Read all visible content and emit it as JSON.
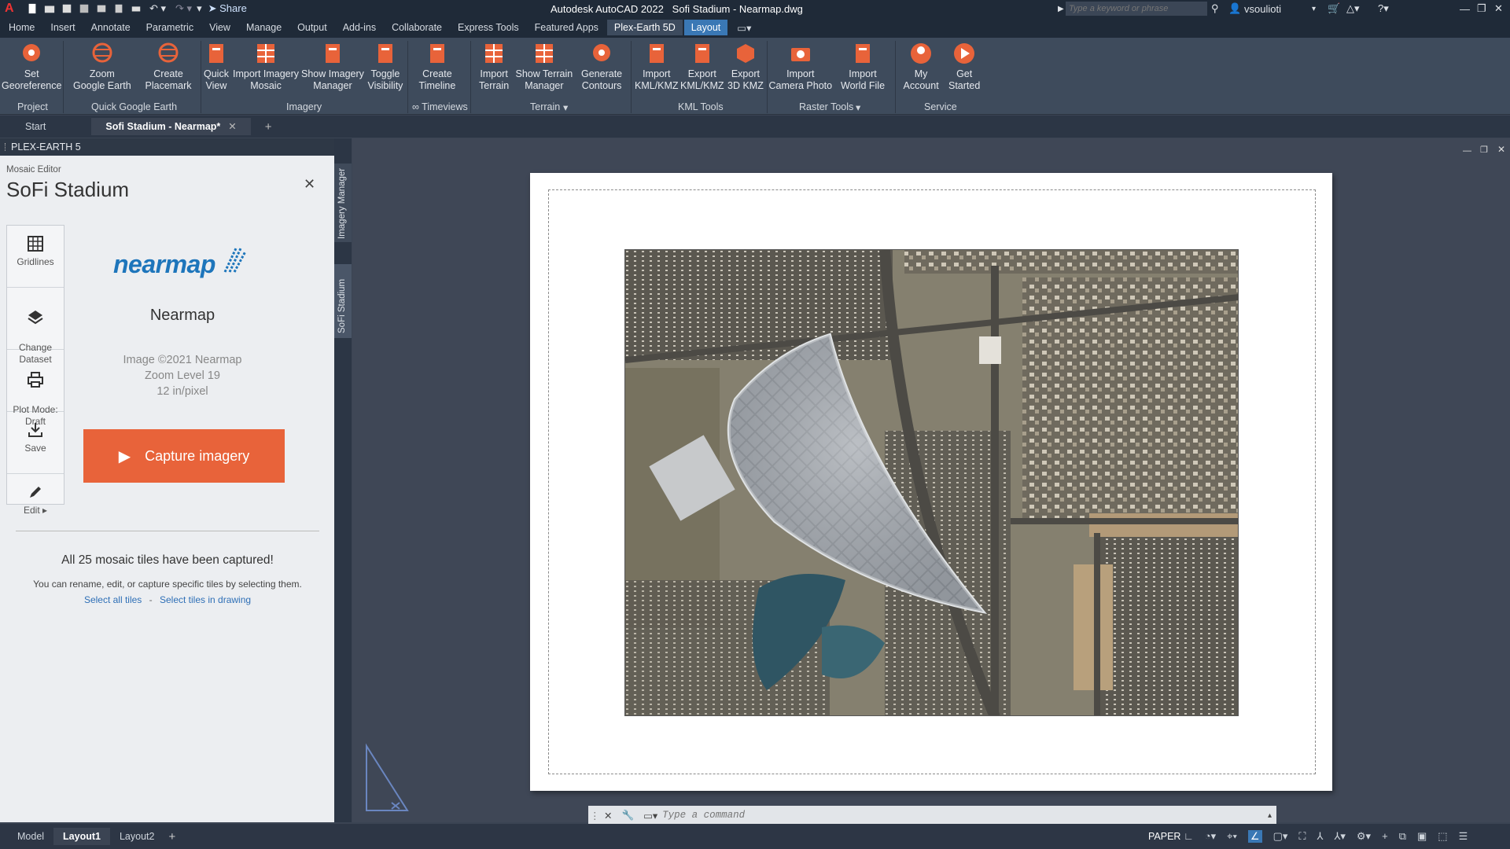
{
  "titlebar": {
    "app": "Autodesk AutoCAD 2022",
    "file": "Sofi Stadium - Nearmap.dwg",
    "share_label": "Share",
    "search_placeholder": "Type a keyword or phrase",
    "user": "vsoulioti"
  },
  "ribbon_tabs": [
    "Home",
    "Insert",
    "Annotate",
    "Parametric",
    "View",
    "Manage",
    "Output",
    "Add-ins",
    "Collaborate",
    "Express Tools",
    "Featured Apps",
    "Plex-Earth 5D",
    "Layout"
  ],
  "ribbon": {
    "buttons": {
      "set_georeference": "Set\nGeoreference",
      "zoom_google_earth": "Zoom\nGoogle Earth",
      "create_placemark": "Create\nPlacemark",
      "quick_view": "Quick\nView",
      "import_imagery_mosaic": "Import Imagery\nMosaic",
      "show_imagery_manager": "Show Imagery\nManager",
      "toggle_visibility": "Toggle\nVisibility",
      "create_timeline": "Create\nTimeline",
      "import_terrain": "Import\nTerrain",
      "show_terrain_manager": "Show Terrain\nManager",
      "generate_contours": "Generate\nContours",
      "import_kml": "Import\nKML/KMZ",
      "export_kml": "Export\nKML/KMZ",
      "export_3d_kmz": "Export\n3D KMZ",
      "import_camera_photo": "Import\nCamera Photo",
      "import_world_file": "Import\nWorld File",
      "my_account": "My\nAccount",
      "get_started": "Get\nStarted"
    },
    "panels": {
      "project": "Project",
      "quick_google_earth": "Quick Google Earth",
      "imagery": "Imagery",
      "timeviews": "∞ Timeviews",
      "terrain": "Terrain",
      "kml_tools": "KML Tools",
      "raster_tools": "Raster Tools",
      "service": "Service"
    }
  },
  "doc_tabs": {
    "start": "Start",
    "current": "Sofi Stadium - Nearmap*"
  },
  "palette": {
    "header": "PLEX-EARTH 5",
    "subtitle": "Mosaic Editor",
    "title": "SoFi Stadium",
    "side_tabs": [
      "Imagery Manager",
      "SoFi Stadium"
    ],
    "tools": {
      "gridlines": "Gridlines",
      "change_dataset": "Change\nDataset",
      "plot_mode": "Plot Mode:\nDraft",
      "save": "Save",
      "edit": "Edit ▸"
    },
    "provider": {
      "logo_text": "nearmap",
      "name": "Nearmap",
      "copyright": "Image ©2021 Nearmap",
      "zoom": "Zoom Level 19",
      "resolution": "12 in/pixel"
    },
    "capture_button": "Capture imagery",
    "status_title": "All 25 mosaic tiles have been captured!",
    "status_text": "You can rename, edit, or capture specific tiles by selecting them.",
    "select_all": "Select all tiles",
    "link_separator": "-",
    "select_in_drawing": "Select tiles in drawing"
  },
  "command": {
    "placeholder": "Type a command"
  },
  "layout_tabs": [
    "Model",
    "Layout1",
    "Layout2"
  ],
  "status": {
    "paper": "PAPER"
  },
  "colors": {
    "accent": "#e8633a",
    "ribbon_bg": "#3e4b5c",
    "link": "#2e6fb6"
  }
}
